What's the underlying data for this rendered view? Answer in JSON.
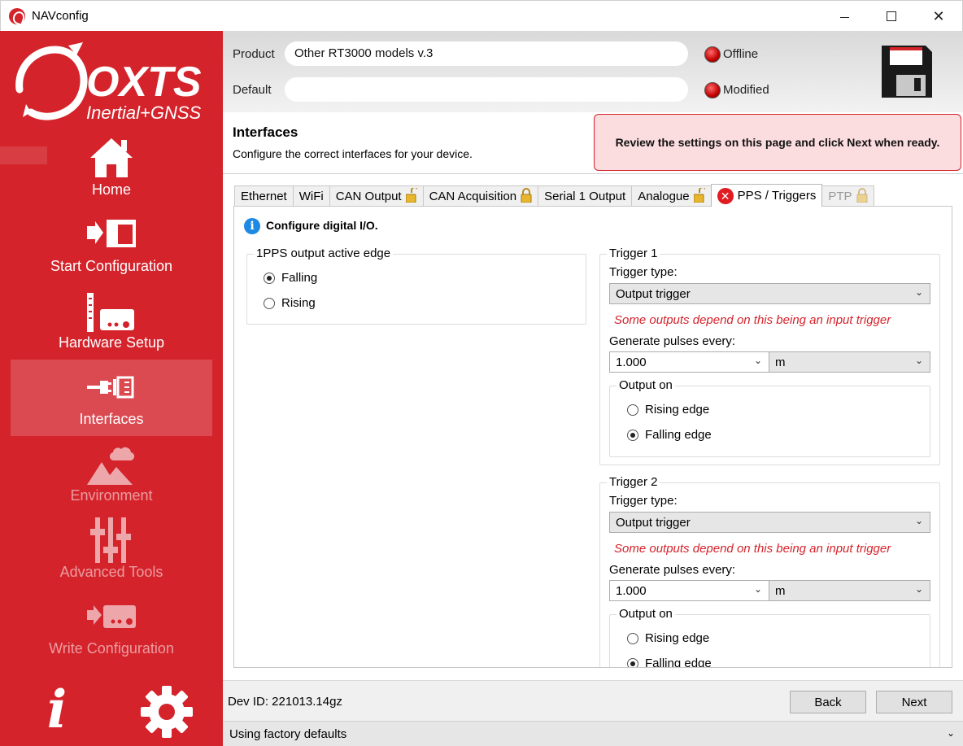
{
  "window": {
    "title": "NAVconfig",
    "close_glyph": "✕"
  },
  "brand": {
    "name": "OXTS",
    "tagline": "Inertial+GNSS",
    "color": "#d4232b"
  },
  "nav": [
    {
      "label": "Home",
      "icon": "home-icon",
      "state": "enabled"
    },
    {
      "label": "Start Configuration",
      "icon": "start-config-icon",
      "state": "enabled"
    },
    {
      "label": "Hardware Setup",
      "icon": "hardware-icon",
      "state": "enabled"
    },
    {
      "label": "Interfaces",
      "icon": "interfaces-icon",
      "state": "active"
    },
    {
      "label": "Environment",
      "icon": "environment-icon",
      "state": "disabled"
    },
    {
      "label": "Advanced Tools",
      "icon": "advanced-tools-icon",
      "state": "disabled"
    },
    {
      "label": "Write Configuration",
      "icon": "write-config-icon",
      "state": "disabled"
    }
  ],
  "sidebar_bottom": {
    "info_glyph": "i",
    "settings_icon": "gear-icon"
  },
  "header": {
    "product_label": "Product",
    "product_value": "Other RT3000 models v.3",
    "default_label": "Default",
    "default_value": "",
    "status_offline": "Offline",
    "status_modified": "Modified",
    "save_icon": "floppy-disk-icon"
  },
  "page": {
    "title": "Interfaces",
    "subtitle": "Configure the correct interfaces for your device.",
    "notice": "Review the settings on this page and click Next when ready."
  },
  "tabs": [
    {
      "label": "Ethernet",
      "lock": false,
      "state": "normal"
    },
    {
      "label": "WiFi",
      "lock": false,
      "state": "normal"
    },
    {
      "label": "CAN Output",
      "lock": "open",
      "state": "normal"
    },
    {
      "label": "CAN Acquisition",
      "lock": "closed",
      "state": "normal"
    },
    {
      "label": "Serial 1 Output",
      "lock": false,
      "state": "normal"
    },
    {
      "label": "Analogue",
      "lock": "open",
      "state": "normal"
    },
    {
      "label": "PPS / Triggers",
      "lock": false,
      "state": "active",
      "error": true
    },
    {
      "label": "PTP",
      "lock": "closed",
      "state": "disabled"
    }
  ],
  "pps_panel": {
    "heading": "Configure digital I/O.",
    "error_glyph": "✕",
    "info_glyph": "i",
    "pps_group": {
      "title": "1PPS output active edge",
      "options": [
        "Falling",
        "Rising"
      ],
      "selected": "Falling"
    },
    "trigger1": {
      "title": "Trigger 1",
      "type_label": "Trigger type:",
      "type_value": "Output trigger",
      "warning": "Some outputs depend on this being an input trigger",
      "pulses_label": "Generate pulses every:",
      "pulses_value": "1.000",
      "unit_value": "m",
      "output_on_title": "Output on",
      "output_options": [
        "Rising edge",
        "Falling edge"
      ],
      "selected": "Falling edge"
    },
    "trigger2": {
      "title": "Trigger 2",
      "type_label": "Trigger type:",
      "type_value": "Output trigger",
      "warning": "Some outputs depend on this being an input trigger",
      "pulses_label": "Generate pulses every:",
      "pulses_value": "1.000",
      "unit_value": "m",
      "output_on_title": "Output on",
      "output_options": [
        "Rising edge",
        "Falling edge"
      ],
      "selected": "Falling edge"
    }
  },
  "footer": {
    "dev_id": "Dev ID: 221013.14gz",
    "back_label": "Back",
    "next_label": "Next",
    "status_text": "Using factory defaults",
    "chevron": "⌄"
  }
}
